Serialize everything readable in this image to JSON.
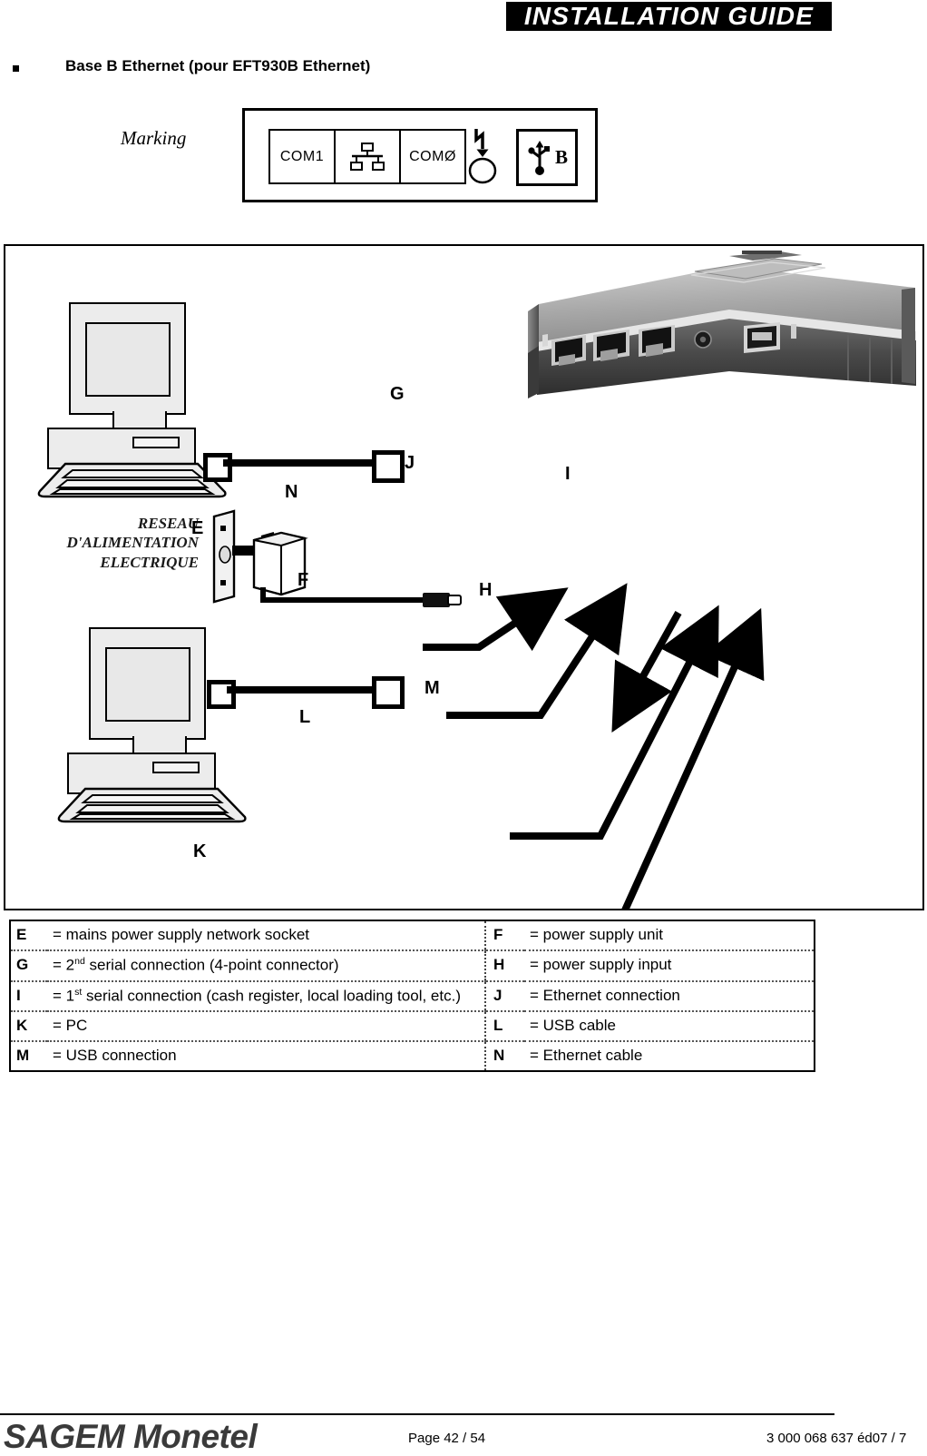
{
  "header": {
    "banner_title": "INSTALLATION GUIDE"
  },
  "section": {
    "bullet_icon": "square-bullet-icon",
    "heading": "Base B Ethernet (pour EFT930B Ethernet)"
  },
  "marking": {
    "label": "Marking",
    "ports": [
      {
        "label": "COM1",
        "icon": "serial-port-label"
      },
      {
        "label": "",
        "icon": "ethernet-network-icon"
      },
      {
        "label": "COMØ",
        "icon": "serial-port-label"
      }
    ],
    "power_symbol_icon": "power-input-icon",
    "usb_symbol_icon": "usb-trident-icon",
    "usb_letter": "B"
  },
  "diagram": {
    "mains_text_lines": [
      "RESEAU",
      "D'ALIMENTATION",
      "ELECTRIQUE"
    ],
    "labels": {
      "E": "E",
      "F": "F",
      "G": "G",
      "H": "H",
      "I": "I",
      "J": "J",
      "K": "K",
      "L": "L",
      "M": "M",
      "N": "N"
    },
    "device_photo_alt": "payment-terminal-base-rear-ports"
  },
  "legend": {
    "rows": [
      {
        "left_key": "E",
        "left_value": "= mains power supply network socket",
        "right_key": "F",
        "right_value": "= power supply unit"
      },
      {
        "left_key": "G",
        "left_value_pre": "= 2",
        "left_value_sup": "nd",
        "left_value_post": " serial connection (4-point connector)",
        "right_key": "H",
        "right_value": "= power supply input"
      },
      {
        "left_key": "I",
        "left_value_pre": "= 1",
        "left_value_sup": "st",
        "left_value_post": " serial connection (cash register, local loading tool, etc.)",
        "right_key": "J",
        "right_value": "= Ethernet connection"
      },
      {
        "left_key": "K",
        "left_value": "= PC",
        "right_key": "L",
        "right_value": "= USB cable"
      },
      {
        "left_key": "M",
        "left_value": "= USB connection",
        "right_key": "N",
        "right_value": "= Ethernet cable"
      }
    ]
  },
  "footer": {
    "logo": "SAGEM Monetel",
    "page": "Page 42 / 54",
    "reference": "3 000 068 637 éd07 / 7"
  }
}
